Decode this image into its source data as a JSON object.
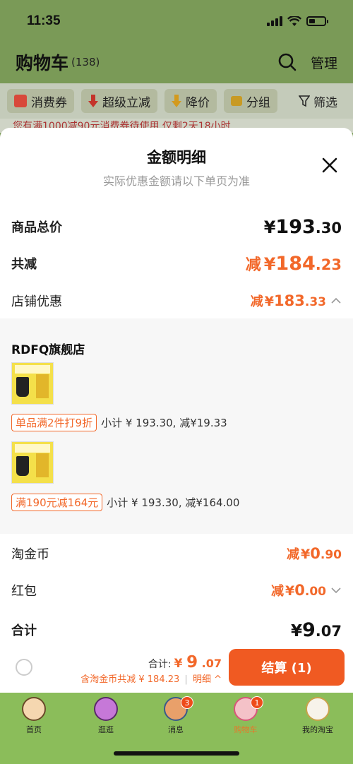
{
  "status_bar": {
    "time": "11:35"
  },
  "header": {
    "title": "购物车",
    "count": "(138)",
    "manage": "管理"
  },
  "filters": {
    "chips": [
      "消费券",
      "超级立减",
      "降价",
      "分组"
    ],
    "filter_label": "筛选"
  },
  "notice": {
    "text": "您有满1000减90元消费券待使用,仅剩2天18小时"
  },
  "sheet": {
    "title": "金额明细",
    "subtitle": "实际优惠金额请以下单页为准",
    "goods_total": {
      "label": "商品总价",
      "symbol": "¥",
      "int": "193",
      "dec": ".30"
    },
    "total_reduction": {
      "label": "共减",
      "prefix": "减",
      "symbol": "¥",
      "int": "184",
      "dec": ".23"
    },
    "store_discount": {
      "label": "店铺优惠",
      "prefix": "减",
      "symbol": "¥",
      "int": "183",
      "dec": ".33"
    },
    "store": {
      "name": "RDFQ旗舰店",
      "items": [
        {
          "promo_tag": "单品满2件打9折",
          "detail": "小计 ¥ 193.30, 减¥19.33"
        },
        {
          "promo_tag": "满190元减164元",
          "detail": "小计 ¥ 193.30, 减¥164.00"
        }
      ]
    },
    "coins": {
      "label": "淘金币",
      "prefix": "减",
      "symbol": "¥",
      "int": "0",
      "dec": ".90"
    },
    "red_packet": {
      "label": "红包",
      "prefix": "减",
      "symbol": "¥",
      "int": "0",
      "dec": ".00"
    },
    "sum": {
      "label": "合计",
      "symbol": "¥",
      "int": "9",
      "dec": ".07"
    }
  },
  "checkout": {
    "total_label": "合计:",
    "total_symbol": "¥",
    "total_int": "9",
    "total_dec": ".07",
    "sub_text": "含淘金币共减 ¥ 184.23",
    "detail_link": "明细",
    "button": "结算 (1)"
  },
  "tabbar": {
    "tabs": [
      {
        "label": "首页"
      },
      {
        "label": "逛逛"
      },
      {
        "label": "消息",
        "badge": "3"
      },
      {
        "label": "购物车",
        "badge": "1"
      },
      {
        "label": "我的淘宝"
      }
    ]
  },
  "colors": {
    "accent": "#f2682a",
    "checkout_button": "#f05a22",
    "tabbar": "#8bbd5a"
  }
}
